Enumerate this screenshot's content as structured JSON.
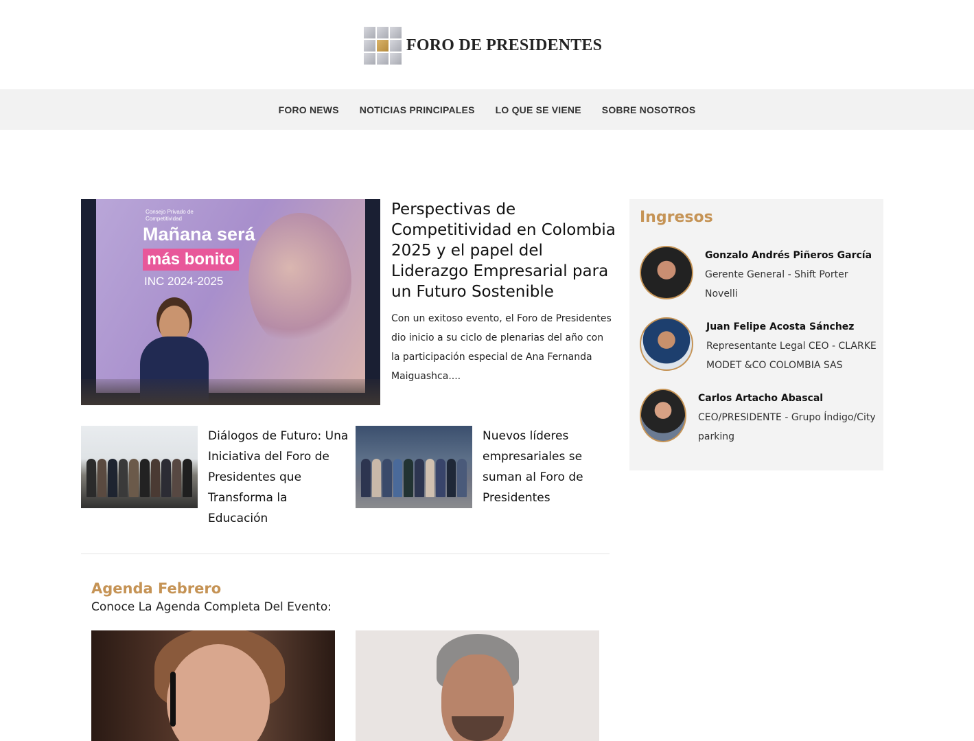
{
  "header": {
    "logo_text": "FORO DE PRESIDENTES"
  },
  "nav": {
    "items": [
      {
        "label": "FORO NEWS"
      },
      {
        "label": "NOTICIAS PRINCIPALES"
      },
      {
        "label": "LO QUE SE VIENE"
      },
      {
        "label": "SOBRE NOSOTROS"
      }
    ]
  },
  "featured": {
    "image_text": {
      "org": "Consejo Privado de Competitividad",
      "line1": "Mañana será",
      "line2": "más bonito",
      "line3": "INC 2024-2025"
    },
    "title": "Perspectivas de Competitividad en Colombia 2025 y el papel del Liderazgo Empresarial para un Futuro Sostenible",
    "excerpt": "Con un exitoso evento, el Foro de Presidentes dio inicio a su ciclo de plenarias del año con la participación especial de Ana Fernanda Maiguashca...."
  },
  "articles": [
    {
      "title": "Diálogos de Futuro: Una Iniciativa del Foro de Presidentes que Transforma la Educación"
    },
    {
      "title": "Nuevos líderes empresariales se suman al Foro de Presidentes"
    }
  ],
  "agenda": {
    "title": "Agenda Febrero",
    "subtitle": "Conoce La Agenda Completa Del Evento:"
  },
  "sidebar": {
    "title": "Ingresos",
    "members": [
      {
        "name": "Gonzalo Andrés Piñeros García",
        "role": "Gerente General - Shift Porter Novelli"
      },
      {
        "name": "Juan Felipe Acosta Sánchez",
        "role": "Representante Legal CEO - CLARKE MODET &CO COLOMBIA SAS"
      },
      {
        "name": "Carlos Artacho Abascal",
        "role": "CEO/PRESIDENTE - Grupo Índigo/City parking"
      }
    ]
  },
  "colors": {
    "accent": "#c59355",
    "nav_bg": "#f2f2f2",
    "sidebar_bg": "#f3f3f3"
  }
}
